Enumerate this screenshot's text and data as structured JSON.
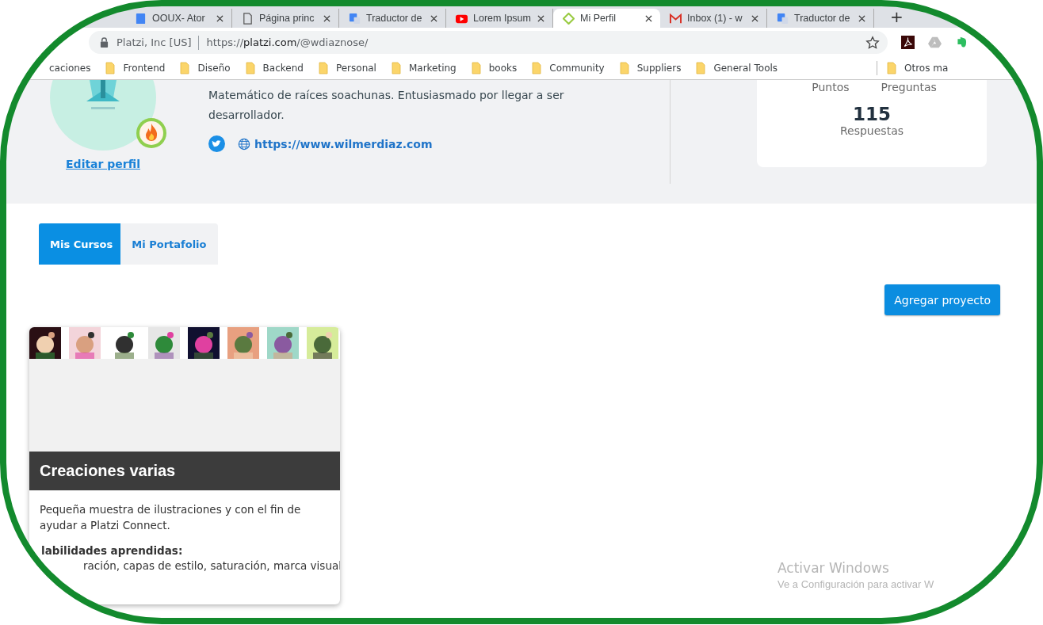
{
  "browser": {
    "tabs": [
      {
        "title": "OOUX- Ator",
        "kind": "doc",
        "selected": false
      },
      {
        "title": "Página princ",
        "kind": "page",
        "selected": false
      },
      {
        "title": "Traductor de",
        "kind": "translate",
        "selected": false
      },
      {
        "title": "Lorem Ipsum",
        "kind": "video",
        "selected": false
      },
      {
        "title": "Mi Perfil",
        "kind": "platzi",
        "selected": true
      },
      {
        "title": "Inbox (1) - w",
        "kind": "mail",
        "selected": false
      },
      {
        "title": "Traductor de",
        "kind": "translate",
        "selected": false
      }
    ],
    "new_tab": "+",
    "site_identity": "Platzi, Inc [US]",
    "url": {
      "scheme": "https://",
      "host": "platzi.com",
      "path": "/@wdiaznose/"
    },
    "bookmarks": [
      {
        "label": "caciones",
        "kind": "cut"
      },
      {
        "label": "Frontend",
        "kind": "folder"
      },
      {
        "label": "Diseño",
        "kind": "folder"
      },
      {
        "label": "Backend",
        "kind": "folder"
      },
      {
        "label": "Personal",
        "kind": "folder"
      },
      {
        "label": "Marketing",
        "kind": "folder"
      },
      {
        "label": "books",
        "kind": "folder"
      },
      {
        "label": "Community",
        "kind": "folder"
      },
      {
        "label": "Suppliers",
        "kind": "folder"
      },
      {
        "label": "General Tools",
        "kind": "folder"
      }
    ],
    "other_bookmarks": "Otros ma"
  },
  "profile": {
    "edit_link": "Editar perfil",
    "bio": "Matemático de raíces soachunas. Entusiasmado por llegar a ser desarrollador.",
    "website": "https://www.wilmerdiaz.com",
    "stats": {
      "labels": [
        "Puntos",
        "Preguntas"
      ],
      "value": "115",
      "value_label": "Respuestas"
    }
  },
  "tabs": [
    {
      "label": "Mis Cursos",
      "selected": true
    },
    {
      "label": "Mi Portafolio",
      "selected": false
    }
  ],
  "add_button": "Agregar proyecto",
  "project": {
    "title": "Creaciones varias",
    "description": "Pequeña muestra de ilustraciones y con el fin de ayudar a Platzi Connect.",
    "skills_heading": "labilidades aprendidas:",
    "skills": "ración, capas de estilo, saturación, marca visual"
  },
  "windows_notice": {
    "title": "Activar Windows",
    "text": "Ve a Configuración para activar W"
  }
}
